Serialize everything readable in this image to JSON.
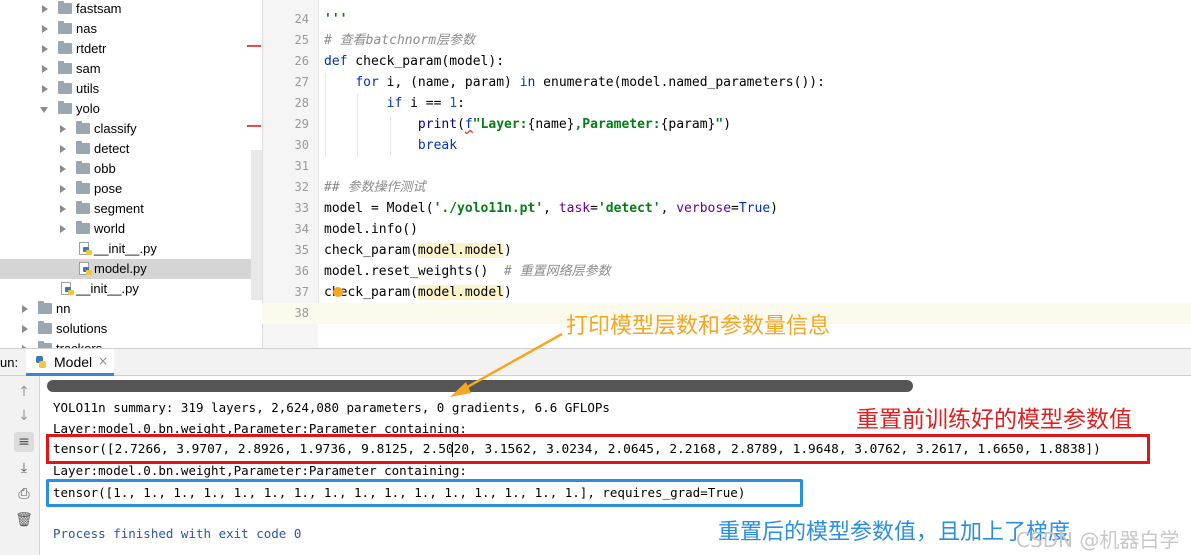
{
  "project_tree": {
    "items": [
      {
        "label": "fastsam",
        "type": "folder",
        "expanded": false,
        "indent": 0
      },
      {
        "label": "nas",
        "type": "folder",
        "expanded": false,
        "indent": 0
      },
      {
        "label": "rtdetr",
        "type": "folder",
        "expanded": false,
        "indent": 0
      },
      {
        "label": "sam",
        "type": "folder",
        "expanded": false,
        "indent": 0
      },
      {
        "label": "utils",
        "type": "folder",
        "expanded": false,
        "indent": 0
      },
      {
        "label": "yolo",
        "type": "folder",
        "expanded": true,
        "indent": 0
      },
      {
        "label": "classify",
        "type": "folder",
        "expanded": false,
        "indent": 1
      },
      {
        "label": "detect",
        "type": "folder",
        "expanded": false,
        "indent": 1
      },
      {
        "label": "obb",
        "type": "folder",
        "expanded": false,
        "indent": 1
      },
      {
        "label": "pose",
        "type": "folder",
        "expanded": false,
        "indent": 1
      },
      {
        "label": "segment",
        "type": "folder",
        "expanded": false,
        "indent": 1
      },
      {
        "label": "world",
        "type": "folder",
        "expanded": false,
        "indent": 1
      },
      {
        "label": "__init__.py",
        "type": "file",
        "indent": 1
      },
      {
        "label": "model.py",
        "type": "file",
        "indent": 1,
        "selected": true
      },
      {
        "label": "__init__.py",
        "type": "file",
        "indent": 0
      },
      {
        "label": "nn",
        "type": "folder",
        "expanded": false,
        "indent": -1
      },
      {
        "label": "solutions",
        "type": "folder",
        "expanded": false,
        "indent": -1
      },
      {
        "label": "trackers",
        "type": "folder",
        "expanded": false,
        "indent": -1
      }
    ]
  },
  "editor": {
    "line_numbers": [
      "24",
      "25",
      "26",
      "27",
      "28",
      "29",
      "30",
      "31",
      "32",
      "33",
      "34",
      "35",
      "36",
      "37",
      "38"
    ],
    "lines": {
      "l24": "'''",
      "l25": "# 查看batchnorm层参数",
      "l26_kw": "def",
      "l26_rest": " check_param(model):",
      "l27_for": "for",
      "l27_mid": " i, (name, param) ",
      "l27_in": "in",
      "l27_rest": " enumerate(model.named_parameters()):",
      "l28_if": "if",
      "l28_mid": " i == ",
      "l28_num": "1",
      "l28_end": ":",
      "l29_print": "print",
      "l29_open": "(",
      "l29_f": "f",
      "l29_s1": "\"Layer:",
      "l29_name": "{name}",
      "l29_s2": ",Parameter:",
      "l29_param": "{param}",
      "l29_s3": "\"",
      "l29_close": ")",
      "l30_break": "break",
      "l32": "## 参数操作测试",
      "l33_a": "model = Model(",
      "l33_str1": "'./yolo11n.pt'",
      "l33_b": ", ",
      "l33_kw1": "task",
      "l33_c": "=",
      "l33_str2": "'detect'",
      "l33_d": ", ",
      "l33_kw2": "verbose",
      "l33_e": "=",
      "l33_true": "True",
      "l33_f": ")",
      "l34": "model.info()",
      "l35_a": "check_param(",
      "l35_hl": "model.model",
      "l35_b": ")",
      "l36_a": "model.reset_weights()  ",
      "l36_cm": "# 重置网络层参数",
      "l37_a": "check_param(",
      "l37_hl": "model.model",
      "l37_b": ")"
    }
  },
  "run_panel": {
    "label": "un:",
    "tab_label": "Model",
    "tab_close": "×",
    "toolbar_icons": [
      "arrow-up-icon",
      "arrow-down-icon",
      "soft-wrap-icon",
      "scroll-to-end-icon",
      "print-icon",
      "trash-icon"
    ],
    "output": {
      "summary": "YOLO11n summary: 319 layers, 2,624,080 parameters, 0 gradients, 6.6 GFLOPs",
      "layer1": "Layer:model.0.bn.weight,Parameter:Parameter containing:",
      "tensor1": "tensor([2.7266, 3.9707, 2.8926, 1.9736, 9.8125, 2.5020, 3.1562, 3.0234, 2.0645, 2.2168, 2.8789, 1.9648, 3.0762, 3.2617, 1.6650, 1.8838])",
      "layer2": "Layer:model.0.bn.weight,Parameter:Parameter containing:",
      "tensor2": "tensor([1., 1., 1., 1., 1., 1., 1., 1., 1., 1., 1., 1., 1., 1., 1., 1.], requires_grad=True)",
      "finished": "Process finished with exit code 0"
    }
  },
  "annotations": {
    "print_info": "打印模型层数和参数量信息",
    "before_reset": "重置前训练好的模型参数值",
    "after_reset": "重置后的模型参数值，且加上了梯度",
    "watermark": "CSDN @机器白学"
  },
  "colors": {
    "annotation_orange": "#f5a623",
    "annotation_red": "#e02020",
    "annotation_blue": "#2b8fe0"
  }
}
